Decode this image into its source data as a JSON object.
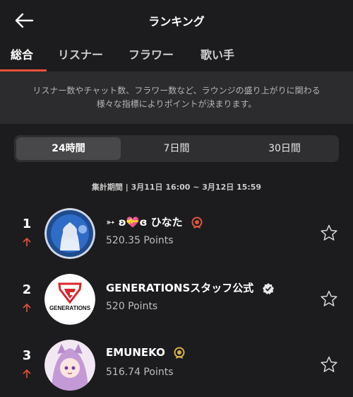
{
  "header": {
    "title": "ランキング"
  },
  "tabs": [
    {
      "label": "総合",
      "active": true
    },
    {
      "label": "リスナー",
      "active": false
    },
    {
      "label": "フラワー",
      "active": false
    },
    {
      "label": "歌い手",
      "active": false
    }
  ],
  "description": {
    "line1": "リスナー数やチャット数、フラワー数など、ラウンジの盛り上がりに関わる",
    "line2": "様々な指標によりポイントが決まります。"
  },
  "period_tabs": [
    {
      "label": "24時間",
      "active": true
    },
    {
      "label": "7日間",
      "active": false
    },
    {
      "label": "30日間",
      "active": false
    }
  ],
  "period_text": "集計期間 | 3月11日 16:00 ~ 3月12日 15:59",
  "rankings": [
    {
      "rank": "1",
      "name": "➳ ʚ💝ɞ ひなた",
      "points": "520.35 Points",
      "trend": "up",
      "badge": "red-medal-icon"
    },
    {
      "rank": "2",
      "name": "GENERATIONSスタッフ公式",
      "points": "520 Points",
      "trend": "up",
      "badge": "verified-check-icon",
      "avatar_text": "GENERATIONS"
    },
    {
      "rank": "3",
      "name": "EMUNEKO",
      "points": "516.74 Points",
      "trend": "up",
      "badge": "gold-medal-icon"
    }
  ],
  "colors": {
    "accent": "#e8513a",
    "background": "#1c1c1e",
    "gold": "#d8b34a",
    "red_badge": "#e0563f"
  }
}
